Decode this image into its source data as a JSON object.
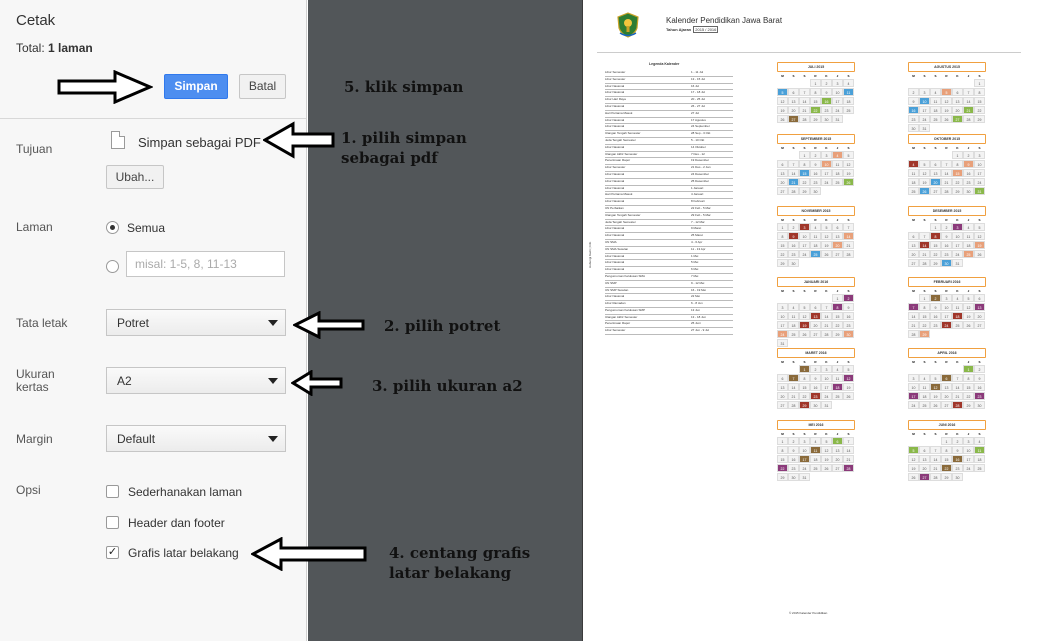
{
  "panel": {
    "title": "Cetak",
    "total_label": "Total:",
    "total_value": "1 laman",
    "save_label": "Simpan",
    "cancel_label": "Batal",
    "destination": {
      "label": "Tujuan",
      "value": "Simpan sebagai PDF",
      "change_label": "Ubah..."
    },
    "pages": {
      "label": "Laman",
      "all_label": "Semua",
      "custom_placeholder": "misal: 1-5, 8, 11-13"
    },
    "layout": {
      "label": "Tata letak",
      "value": "Potret"
    },
    "paper_size": {
      "label": "Ukuran\nkertas",
      "label_line1": "Ukuran",
      "label_line2": "kertas",
      "value": "A2"
    },
    "margins": {
      "label": "Margin",
      "value": "Default"
    },
    "options": {
      "label": "Opsi",
      "items": [
        {
          "label": "Sederhanakan laman",
          "checked": false
        },
        {
          "label": "Header dan footer",
          "checked": false
        },
        {
          "label": "Grafis latar belakang",
          "checked": true
        }
      ]
    }
  },
  "annotations": {
    "step5": "5. klik simpan",
    "step1_line1": "1. pilih simpan",
    "step1_line2": "sebagai pdf",
    "step2": "2. pilih potret",
    "step3": "3. pilih ukuran a2",
    "step4_line1": "4. centang grafis",
    "step4_line2": "latar belakang"
  },
  "preview": {
    "title": "Kalender Pendidikan Jawa Barat",
    "subtitle_label": "Tahun Ajaran",
    "subtitle_value": "2015 / 2016",
    "legend_title": "Legenda Kalender",
    "side_label": "Hubungi Kami | Info",
    "footnote": "© 2015 Kalender Pendidikan",
    "legend_rows": [
      [
        "Libur Semester",
        "1 - 11 Jul"
      ],
      [
        "Libur Semester",
        "13 - 15 Jul"
      ],
      [
        "Libur Nasional",
        "16 Jul"
      ],
      [
        "Libur Nasional",
        "17 - 18 Jul"
      ],
      [
        "Libur Hari Raya",
        "20 - 25 Jul"
      ],
      [
        "Libur Nasional",
        "26 - 27 Jul"
      ],
      [
        "Hari Pertama Masuk",
        "27 Jul"
      ],
      [
        "Libur Nasional",
        "17 Agustus"
      ],
      [
        "Libur Nasional",
        "24 September"
      ],
      [
        "Ulangan Tengah Semester",
        "28 Sep - 3 Okt"
      ],
      [
        "Jeda Tengah Semester",
        "5 - 10 Okt"
      ],
      [
        "Libur Nasional",
        "14 Oktober"
      ],
      [
        "Ulangan Akhir Semester",
        "7 Des - 12"
      ],
      [
        "Penerimaan Rapor",
        "19 Desember"
      ],
      [
        "Libur Semester",
        "21 Des - 2 Jan"
      ],
      [
        "Libur Nasional",
        "24 Desember"
      ],
      [
        "Libur Nasional",
        "25 Desember"
      ],
      [
        "Libur Nasional",
        "1 Januari"
      ],
      [
        "Hari Pertama Masuk",
        "4 Januari"
      ],
      [
        "Libur Nasional",
        "8 Februari"
      ],
      [
        "UN Perbaikan",
        "22 Feb - 5 Mar"
      ],
      [
        "Ulangan Tengah Semester",
        "29 Feb - 5 Mar"
      ],
      [
        "Jeda Tengah Semester",
        "7 - 12 Mar"
      ],
      [
        "Libur Nasional",
        "9 Maret"
      ],
      [
        "Libur Nasional",
        "25 Maret"
      ],
      [
        "UN SMA",
        "4 - 6 Apr"
      ],
      [
        "UN SMA Susulan",
        "11 - 13 Apr"
      ],
      [
        "Libur Nasional",
        "1 Mei"
      ],
      [
        "Libur Nasional",
        "5 Mei"
      ],
      [
        "Libur Nasional",
        "6 Mei"
      ],
      [
        "Pengumuman Kelulusan SMA",
        "7 Mei"
      ],
      [
        "UN SMP",
        "9 - 12 Mei"
      ],
      [
        "UN SMP Susulan",
        "16 - 19 Mei"
      ],
      [
        "Libur Nasional",
        "22 Mei"
      ],
      [
        "Libur Ramadan",
        "6 - 8 Jun"
      ],
      [
        "Pengumuman Kelulusan SMP",
        "13 Jun"
      ],
      [
        "Ulangan Akhir Semester",
        "13 - 18 Jun"
      ],
      [
        "Penerimaan Rapor",
        "25 Juni"
      ],
      [
        "Libur Semester",
        "27 Jun - 9 Jul"
      ]
    ],
    "days_of_week": [
      "M",
      "S",
      "S",
      "R",
      "K",
      "J",
      "S"
    ],
    "months": [
      {
        "name": "JULI 2015",
        "offset": 3,
        "days": 31
      },
      {
        "name": "AGUSTUS 2015",
        "offset": 6,
        "days": 31
      },
      {
        "name": "SEPTEMBER 2015",
        "offset": 2,
        "days": 30
      },
      {
        "name": "OKTOBER 2015",
        "offset": 4,
        "days": 31
      },
      {
        "name": "NOVEMBER 2015",
        "offset": 0,
        "days": 30
      },
      {
        "name": "DESEMBER 2015",
        "offset": 2,
        "days": 31
      },
      {
        "name": "JANUARI 2016",
        "offset": 5,
        "days": 31
      },
      {
        "name": "FEBRUARI 2016",
        "offset": 1,
        "days": 29
      },
      {
        "name": "MARET 2016",
        "offset": 2,
        "days": 31
      },
      {
        "name": "APRIL 2016",
        "offset": 5,
        "days": 30
      },
      {
        "name": "MEI 2016",
        "offset": 0,
        "days": 31
      },
      {
        "name": "JUNI 2016",
        "offset": 3,
        "days": 30
      }
    ],
    "colors": {
      "accent_button": "#4d8ef0",
      "gap_background": "#525659",
      "month_border": "#f0a040",
      "holiday": "#e8a07a",
      "holiday_dark": "#a0362a",
      "exam": "#8b3a7a",
      "brown": "#8a6a3a",
      "green": "#8ab84a",
      "blue": "#4aa0d8"
    }
  }
}
